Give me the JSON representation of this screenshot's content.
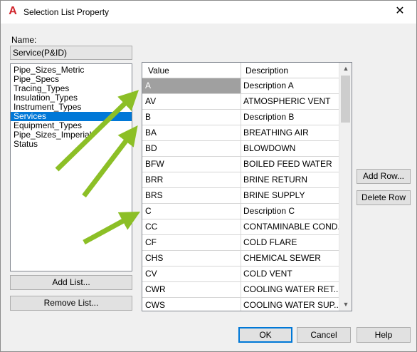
{
  "window": {
    "title": "Selection List Property",
    "app_icon": "autocad-a-icon",
    "close_glyph": "✕"
  },
  "name": {
    "label": "Name:",
    "value": "Service(P&ID)"
  },
  "lists": {
    "items": [
      {
        "label": "Pipe_Sizes_Metric"
      },
      {
        "label": "Pipe_Specs"
      },
      {
        "label": "Tracing_Types"
      },
      {
        "label": "Insulation_Types"
      },
      {
        "label": "Instrument_Types"
      },
      {
        "label": "Services",
        "selected": true
      },
      {
        "label": "Equipment_Types"
      },
      {
        "label": "Pipe_Sizes_Imperial"
      },
      {
        "label": "Status"
      }
    ],
    "selected_color": "#0078d7"
  },
  "buttons": {
    "add_list": "Add List...",
    "remove_list": "Remove List...",
    "add_row": "Add Row...",
    "delete_row": "Delete Row",
    "ok": "OK",
    "cancel": "Cancel",
    "help": "Help"
  },
  "grid": {
    "headers": {
      "value": "Value",
      "description": "Description"
    },
    "rows": [
      {
        "value": "A",
        "description": "Description A",
        "selected": true
      },
      {
        "value": "AV",
        "description": "ATMOSPHERIC VENT"
      },
      {
        "value": "B",
        "description": "Description B"
      },
      {
        "value": "BA",
        "description": "BREATHING AIR"
      },
      {
        "value": "BD",
        "description": "BLOWDOWN"
      },
      {
        "value": "BFW",
        "description": "BOILED FEED WATER"
      },
      {
        "value": "BRR",
        "description": "BRINE RETURN"
      },
      {
        "value": "BRS",
        "description": "BRINE SUPPLY"
      },
      {
        "value": "C",
        "description": "Description C"
      },
      {
        "value": "CC",
        "description": "CONTAMINABLE COND..."
      },
      {
        "value": "CF",
        "description": "COLD FLARE"
      },
      {
        "value": "CHS",
        "description": "CHEMICAL SEWER"
      },
      {
        "value": "CV",
        "description": "COLD VENT"
      },
      {
        "value": "CWR",
        "description": "COOLING WATER RET..."
      },
      {
        "value": "CWS",
        "description": "COOLING WATER SUP..."
      }
    ],
    "scroll_up_icon": "scroll-up-arrow-icon",
    "scroll_down_icon": "scroll-down-arrow-icon"
  },
  "annotation_arrow_color": "#8cbf26"
}
